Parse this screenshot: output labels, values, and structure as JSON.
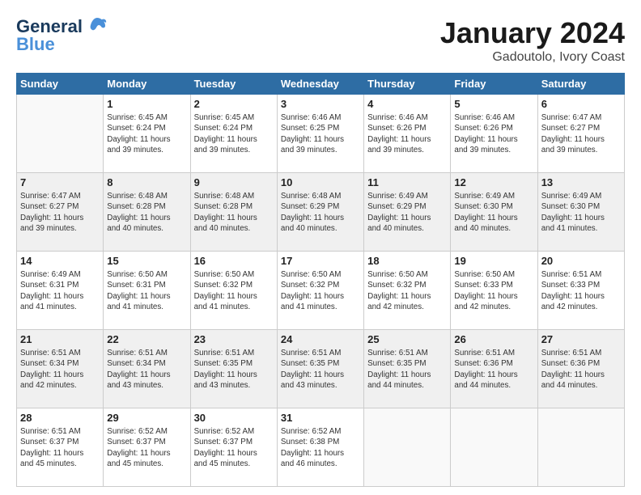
{
  "logo": {
    "line1": "General",
    "line2": "Blue"
  },
  "title": "January 2024",
  "subtitle": "Gadoutolo, Ivory Coast",
  "days_of_week": [
    "Sunday",
    "Monday",
    "Tuesday",
    "Wednesday",
    "Thursday",
    "Friday",
    "Saturday"
  ],
  "weeks": [
    [
      {
        "day": "",
        "info": ""
      },
      {
        "day": "1",
        "info": "Sunrise: 6:45 AM\nSunset: 6:24 PM\nDaylight: 11 hours\nand 39 minutes."
      },
      {
        "day": "2",
        "info": "Sunrise: 6:45 AM\nSunset: 6:24 PM\nDaylight: 11 hours\nand 39 minutes."
      },
      {
        "day": "3",
        "info": "Sunrise: 6:46 AM\nSunset: 6:25 PM\nDaylight: 11 hours\nand 39 minutes."
      },
      {
        "day": "4",
        "info": "Sunrise: 6:46 AM\nSunset: 6:26 PM\nDaylight: 11 hours\nand 39 minutes."
      },
      {
        "day": "5",
        "info": "Sunrise: 6:46 AM\nSunset: 6:26 PM\nDaylight: 11 hours\nand 39 minutes."
      },
      {
        "day": "6",
        "info": "Sunrise: 6:47 AM\nSunset: 6:27 PM\nDaylight: 11 hours\nand 39 minutes."
      }
    ],
    [
      {
        "day": "7",
        "info": "Sunrise: 6:47 AM\nSunset: 6:27 PM\nDaylight: 11 hours\nand 39 minutes."
      },
      {
        "day": "8",
        "info": "Sunrise: 6:48 AM\nSunset: 6:28 PM\nDaylight: 11 hours\nand 40 minutes."
      },
      {
        "day": "9",
        "info": "Sunrise: 6:48 AM\nSunset: 6:28 PM\nDaylight: 11 hours\nand 40 minutes."
      },
      {
        "day": "10",
        "info": "Sunrise: 6:48 AM\nSunset: 6:29 PM\nDaylight: 11 hours\nand 40 minutes."
      },
      {
        "day": "11",
        "info": "Sunrise: 6:49 AM\nSunset: 6:29 PM\nDaylight: 11 hours\nand 40 minutes."
      },
      {
        "day": "12",
        "info": "Sunrise: 6:49 AM\nSunset: 6:30 PM\nDaylight: 11 hours\nand 40 minutes."
      },
      {
        "day": "13",
        "info": "Sunrise: 6:49 AM\nSunset: 6:30 PM\nDaylight: 11 hours\nand 41 minutes."
      }
    ],
    [
      {
        "day": "14",
        "info": "Sunrise: 6:49 AM\nSunset: 6:31 PM\nDaylight: 11 hours\nand 41 minutes."
      },
      {
        "day": "15",
        "info": "Sunrise: 6:50 AM\nSunset: 6:31 PM\nDaylight: 11 hours\nand 41 minutes."
      },
      {
        "day": "16",
        "info": "Sunrise: 6:50 AM\nSunset: 6:32 PM\nDaylight: 11 hours\nand 41 minutes."
      },
      {
        "day": "17",
        "info": "Sunrise: 6:50 AM\nSunset: 6:32 PM\nDaylight: 11 hours\nand 41 minutes."
      },
      {
        "day": "18",
        "info": "Sunrise: 6:50 AM\nSunset: 6:32 PM\nDaylight: 11 hours\nand 42 minutes."
      },
      {
        "day": "19",
        "info": "Sunrise: 6:50 AM\nSunset: 6:33 PM\nDaylight: 11 hours\nand 42 minutes."
      },
      {
        "day": "20",
        "info": "Sunrise: 6:51 AM\nSunset: 6:33 PM\nDaylight: 11 hours\nand 42 minutes."
      }
    ],
    [
      {
        "day": "21",
        "info": "Sunrise: 6:51 AM\nSunset: 6:34 PM\nDaylight: 11 hours\nand 42 minutes."
      },
      {
        "day": "22",
        "info": "Sunrise: 6:51 AM\nSunset: 6:34 PM\nDaylight: 11 hours\nand 43 minutes."
      },
      {
        "day": "23",
        "info": "Sunrise: 6:51 AM\nSunset: 6:35 PM\nDaylight: 11 hours\nand 43 minutes."
      },
      {
        "day": "24",
        "info": "Sunrise: 6:51 AM\nSunset: 6:35 PM\nDaylight: 11 hours\nand 43 minutes."
      },
      {
        "day": "25",
        "info": "Sunrise: 6:51 AM\nSunset: 6:35 PM\nDaylight: 11 hours\nand 44 minutes."
      },
      {
        "day": "26",
        "info": "Sunrise: 6:51 AM\nSunset: 6:36 PM\nDaylight: 11 hours\nand 44 minutes."
      },
      {
        "day": "27",
        "info": "Sunrise: 6:51 AM\nSunset: 6:36 PM\nDaylight: 11 hours\nand 44 minutes."
      }
    ],
    [
      {
        "day": "28",
        "info": "Sunrise: 6:51 AM\nSunset: 6:37 PM\nDaylight: 11 hours\nand 45 minutes."
      },
      {
        "day": "29",
        "info": "Sunrise: 6:52 AM\nSunset: 6:37 PM\nDaylight: 11 hours\nand 45 minutes."
      },
      {
        "day": "30",
        "info": "Sunrise: 6:52 AM\nSunset: 6:37 PM\nDaylight: 11 hours\nand 45 minutes."
      },
      {
        "day": "31",
        "info": "Sunrise: 6:52 AM\nSunset: 6:38 PM\nDaylight: 11 hours\nand 46 minutes."
      },
      {
        "day": "",
        "info": ""
      },
      {
        "day": "",
        "info": ""
      },
      {
        "day": "",
        "info": ""
      }
    ]
  ]
}
